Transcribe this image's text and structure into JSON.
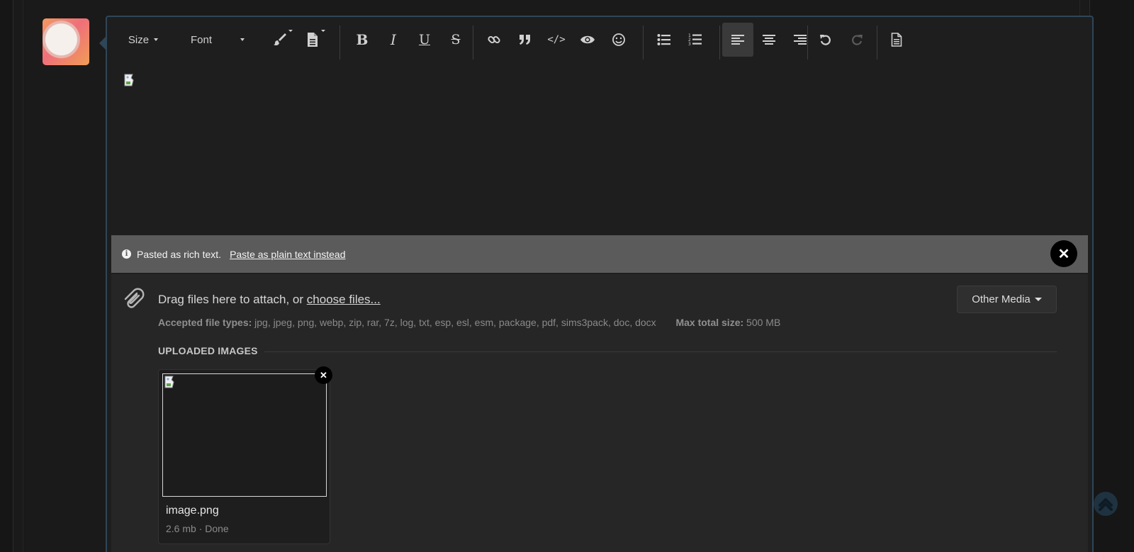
{
  "toolbar": {
    "size_label": "Size",
    "font_label": "Font",
    "buttons": [
      "text-color",
      "paragraph-style",
      "bold",
      "italic",
      "underline",
      "strikethrough",
      "link",
      "quote",
      "code",
      "spoiler",
      "emoji",
      "bulleted-list",
      "numbered-list",
      "align-left",
      "align-center",
      "align-right",
      "undo",
      "redo",
      "toggle-bbcode"
    ],
    "bold_glyph": "B",
    "italic_glyph": "I",
    "underline_glyph": "U",
    "strike_glyph": "S",
    "code_glyph": "</>",
    "active_button": "align-left",
    "disabled_button": "redo"
  },
  "paste_notice": {
    "message": "Pasted as rich text.",
    "link": "Paste as plain text instead",
    "close_glyph": "✕"
  },
  "attachments": {
    "drag_text": "Drag files here to attach, or",
    "choose_link": "choose files...",
    "other_media_label": "Other Media",
    "accepted_label": "Accepted file types:",
    "accepted_types": "jpg, jpeg, png, webp, zip, rar, 7z, log, txt, esp, esl, esm, package, pdf, sims3pack, doc, docx",
    "max_size_label": "Max total size:",
    "max_size_value": "500 MB",
    "uploaded_heading": "UPLOADED IMAGES",
    "files": [
      {
        "name": "image.png",
        "meta": "2.6 mb · Done"
      }
    ],
    "remove_glyph": "✕"
  },
  "colors": {
    "editor_border": "#2e4658",
    "paste_bar": "#5b5b5b",
    "active_button": "#3a3a3a",
    "scroll_top": "#1f3240"
  }
}
